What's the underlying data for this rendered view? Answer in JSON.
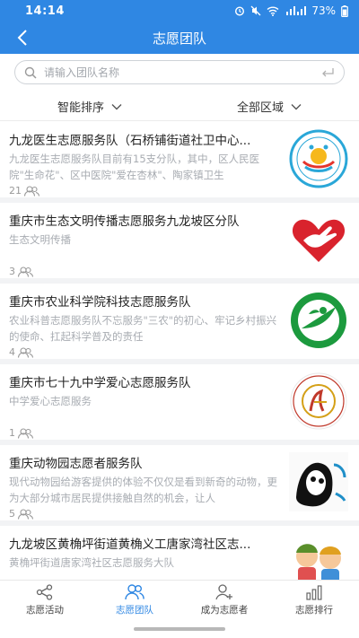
{
  "status": {
    "time": "14:14",
    "battery": "73%"
  },
  "header": {
    "title": "志愿团队"
  },
  "search": {
    "placeholder": "请输入团队名称"
  },
  "filters": [
    {
      "label": "智能排序"
    },
    {
      "label": "全部区域"
    }
  ],
  "teams": [
    {
      "name": "九龙医生志愿服务队（石桥铺街道社卫中心...",
      "desc": "九龙医生志愿服务队目前有15支分队，其中，区人民医院\"生命花\"、区中医院\"爱在杏林\"、陶家镇卫生",
      "count": "21",
      "logo": "community-health-logo"
    },
    {
      "name": "重庆市生态文明传播志愿服务九龙坡区分队",
      "desc": "生态文明传播",
      "count": "3",
      "logo": "red-heart-hand-logo"
    },
    {
      "name": "重庆市农业科学院科技志愿服务队",
      "desc": "农业科普志愿服务队不忘服务\"三农\"的初心、牢记乡村振兴的使命、扛起科学普及的责任",
      "count": "4",
      "logo": "agriculture-academy-logo"
    },
    {
      "name": "重庆市七十九中学爱心志愿服务队",
      "desc": "中学爱心志愿服务",
      "count": "1",
      "logo": "school-79-logo"
    },
    {
      "name": "重庆动物园志愿者服务队",
      "desc": "现代动物园给游客提供的体验不仅仅是看到新奇的动物，更为大部分城市居民提供接触自然的机会，让人",
      "count": "5",
      "logo": "panda-logo"
    },
    {
      "name": "九龙坡区黄桷坪街道黄桷义工唐家湾社区志...",
      "desc": "黄桷坪街道唐家湾社区志愿服务大队",
      "count": "",
      "logo": "cartoon-kids-logo"
    }
  ],
  "tabs": [
    {
      "label": "志愿活动",
      "icon": "share-icon"
    },
    {
      "label": "志愿团队",
      "icon": "team-icon"
    },
    {
      "label": "成为志愿者",
      "icon": "add-user-icon"
    },
    {
      "label": "志愿排行",
      "icon": "bar-chart-icon"
    }
  ],
  "colors": {
    "primary": "#2f87e3",
    "heart_red": "#d9232d",
    "agri_green": "#1c9a3e"
  }
}
